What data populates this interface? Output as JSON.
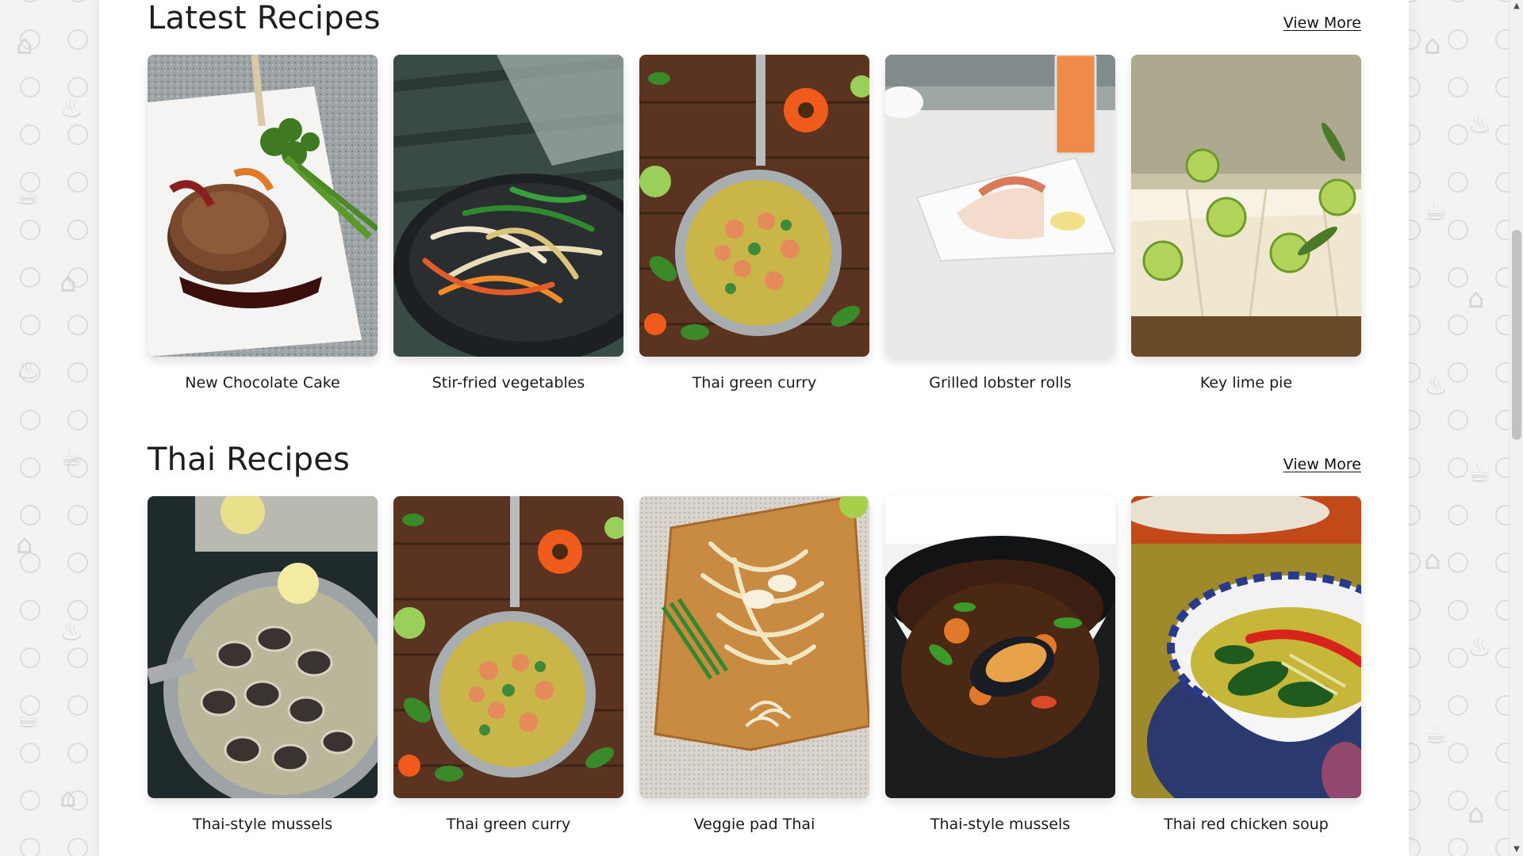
{
  "sections": [
    {
      "title": "Latest Recipes",
      "view_more": "View More",
      "recipes": [
        {
          "title": "New Chocolate Cake",
          "image": "steak-plate"
        },
        {
          "title": "Stir-fried vegetables",
          "image": "stir-fry-pan"
        },
        {
          "title": "Thai green curry",
          "image": "green-curry-pan"
        },
        {
          "title": "Grilled lobster rolls",
          "image": "lobster-plate"
        },
        {
          "title": "Key lime pie",
          "image": "key-lime-pie"
        }
      ]
    },
    {
      "title": "Thai Recipes",
      "view_more": "View More",
      "recipes": [
        {
          "title": "Thai-style mussels",
          "image": "clams-pan"
        },
        {
          "title": "Thai green curry",
          "image": "green-curry-pan"
        },
        {
          "title": "Veggie pad Thai",
          "image": "pad-thai-board"
        },
        {
          "title": "Thai-style mussels",
          "image": "mussels-bowl"
        },
        {
          "title": "Thai red chicken soup",
          "image": "soup-bowl"
        }
      ]
    }
  ],
  "colors": {
    "background": "#f3f3f3",
    "panel": "#ffffff",
    "text": "#1e1e1e"
  }
}
